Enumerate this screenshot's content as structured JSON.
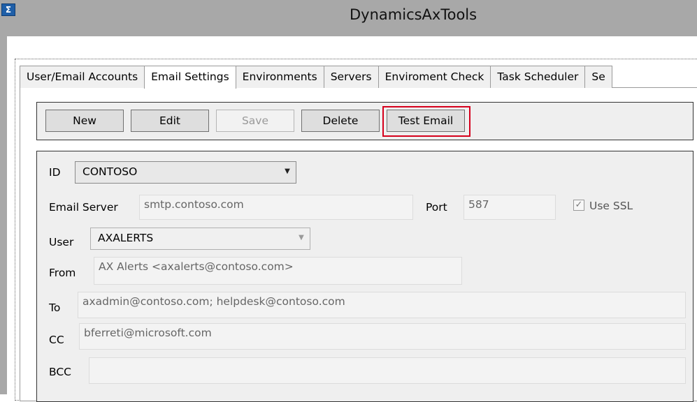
{
  "window": {
    "title": "DynamicsAxTools",
    "icon": "powershell-icon"
  },
  "tabs": [
    {
      "label": "User/Email Accounts",
      "active": false
    },
    {
      "label": "Email Settings",
      "active": true
    },
    {
      "label": "Environments",
      "active": false
    },
    {
      "label": "Servers",
      "active": false
    },
    {
      "label": "Enviroment Check",
      "active": false
    },
    {
      "label": "Task Scheduler",
      "active": false
    },
    {
      "label": "Se",
      "active": false
    }
  ],
  "toolbar": {
    "new_label": "New",
    "edit_label": "Edit",
    "save_label": "Save",
    "delete_label": "Delete",
    "test_email_label": "Test Email"
  },
  "form": {
    "id": {
      "label": "ID",
      "value": "CONTOSO"
    },
    "email_server": {
      "label": "Email Server",
      "value": "smtp.contoso.com"
    },
    "port": {
      "label": "Port",
      "value": "587"
    },
    "use_ssl": {
      "label": "Use SSL",
      "checked": true
    },
    "user": {
      "label": "User",
      "value": "AXALERTS"
    },
    "from": {
      "label": "From",
      "value": "AX Alerts <axalerts@contoso.com>"
    },
    "to": {
      "label": "To",
      "value": "axadmin@contoso.com; helpdesk@contoso.com"
    },
    "cc": {
      "label": "CC",
      "value": "bferreti@microsoft.com"
    },
    "bcc": {
      "label": "BCC",
      "value": ""
    }
  },
  "colors": {
    "highlight_border": "#d6001c",
    "titlebar": "#a8a8a8",
    "panel": "#efefef"
  }
}
